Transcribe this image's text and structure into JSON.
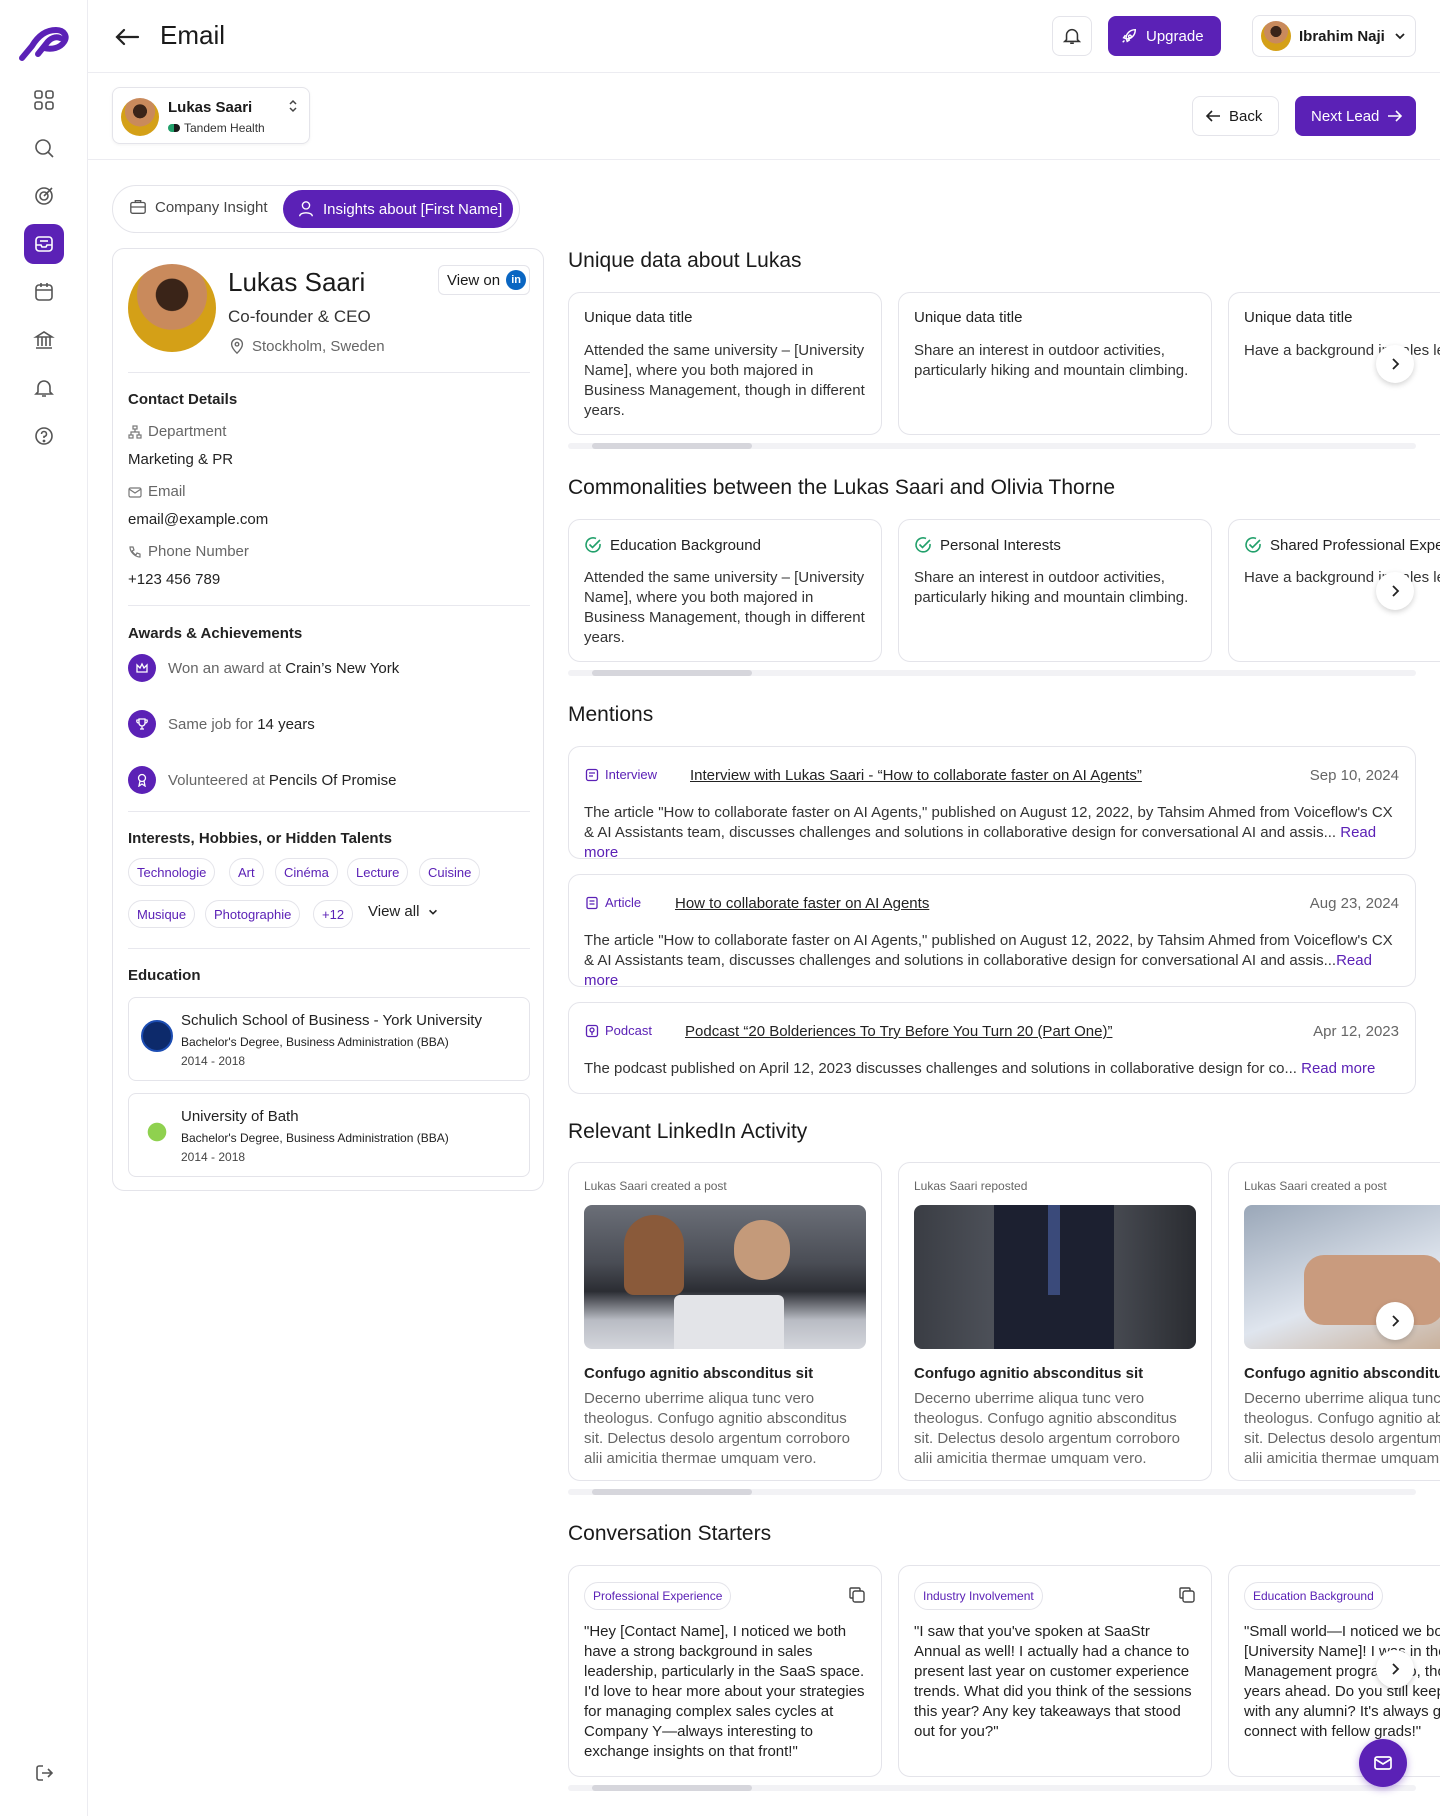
{
  "topbar": {
    "title": "Email",
    "upgrade_label": "Upgrade",
    "user_name": "Ibrahim Naji"
  },
  "lead": {
    "name": "Lukas Saari",
    "company": "Tandem Health",
    "back_label": "Back",
    "next_label": "Next Lead"
  },
  "tabs": {
    "company": "Company Insight",
    "insights": "Insights about [First Name]"
  },
  "profile": {
    "name": "Lukas Saari",
    "role": "Co-founder & CEO",
    "location": "Stockholm, Sweden",
    "view_on": "View on",
    "contact_heading": "Contact Details",
    "department_label": "Department",
    "department": "Marketing & PR",
    "email_label": "Email",
    "email": "email@example.com",
    "phone_label": "Phone Number",
    "phone": "+123 456 789",
    "awards_heading": "Awards & Achievements",
    "awards": [
      {
        "pre": "Won an award at",
        "strong": "Crain’s New York"
      },
      {
        "pre": "Same job for",
        "strong": "14 years"
      },
      {
        "pre": "Volunteered at",
        "strong": "Pencils Of Promise"
      }
    ],
    "interests_heading": "Interests, Hobbies, or Hidden Talents",
    "interests": [
      "Technologie",
      "Art",
      "Cinéma",
      "Lecture",
      "Cuisine",
      "Musique",
      "Photographie",
      "+12"
    ],
    "view_all": "View all",
    "education_heading": "Education",
    "education": [
      {
        "school": "Schulich School of Business - York University",
        "degree": "Bachelor's Degree, Business Administration (BBA)",
        "years": "2014 - 2018"
      },
      {
        "school": "University of Bath",
        "degree": "Bachelor's Degree, Business Administration (BBA)",
        "years": "2014 - 2018"
      }
    ]
  },
  "unique": {
    "heading": "Unique data about Lukas",
    "cards": [
      {
        "title": "Unique data title",
        "body": "Attended the same university – [University Name], where you both majored in Business Management, though in different years."
      },
      {
        "title": "Unique data title",
        "body": "Share an interest in outdoor activities, particularly hiking and mountain climbing."
      },
      {
        "title": "Unique data title",
        "body": "Have a background in sales leadership"
      }
    ]
  },
  "common": {
    "heading": "Commonalities between the Lukas Saari and Olivia Thorne",
    "cards": [
      {
        "title": "Education Background",
        "body": "Attended the same university – [University Name], where you both majored in Business Management, though in different years."
      },
      {
        "title": "Personal Interests",
        "body": "Share an interest in outdoor activities, particularly hiking and mountain climbing."
      },
      {
        "title": "Shared Professional Experience",
        "body": "Have a background in sales leadership"
      }
    ]
  },
  "mentions": {
    "heading": "Mentions",
    "items": [
      {
        "type": "Interview",
        "title": "Interview with Lukas Saari - “How to collaborate faster on AI Agents”",
        "date": "Sep 10, 2024",
        "body": "The article \"How to collaborate faster on AI Agents,\" published on August 12, 2022, by Tahsim Ahmed from Voiceflow's CX & AI Assistants team, discusses challenges and solutions in collaborative design for conversational AI and assis... ",
        "more": "Read more"
      },
      {
        "type": "Article",
        "title": "How to collaborate faster on AI Agents",
        "date": "Aug 23, 2024",
        "body": "The article \"How to collaborate faster on AI Agents,\" published on August 12, 2022, by Tahsim Ahmed from Voiceflow's CX & AI Assistants team, discusses challenges and solutions in collaborative design for conversational AI and assis...",
        "more": "Read more"
      },
      {
        "type": "Podcast",
        "title": "Podcast “20 Bolderiences To Try Before You Turn 20 (Part One)”",
        "date": "Apr 12, 2023",
        "body": "The podcast published on April 12, 2023 discusses challenges and solutions in collaborative design for co... ",
        "more": "Read more"
      }
    ]
  },
  "linkedin": {
    "heading": "Relevant LinkedIn Activity",
    "cards": [
      {
        "header": "Lukas Saari created a post",
        "title": "Confugo agnitio absconditus sit",
        "body": "Decerno uberrime aliqua tunc vero theologus. Confugo agnitio absconditus sit. Delectus desolo argentum corroboro alii amicitia thermae umquam vero."
      },
      {
        "header": "Lukas Saari reposted",
        "title": "Confugo agnitio absconditus sit",
        "body": "Decerno uberrime aliqua tunc vero theologus. Confugo agnitio absconditus sit. Delectus desolo argentum corroboro alii amicitia thermae umquam vero."
      },
      {
        "header": "Lukas Saari created a post",
        "title": "Confugo agnitio absconditus sit",
        "body": "Decerno uberrime aliqua tunc vero theologus. Confugo agnitio absconditus sit. Delectus desolo argentum corroboro alii amicitia thermae umquam vero."
      }
    ]
  },
  "starters": {
    "heading": "Conversation Starters",
    "cards": [
      {
        "tag": "Professional Experience",
        "body": "\"Hey [Contact Name], I noticed we both have a strong background in sales leadership, particularly in the SaaS space. I'd love to hear more about your strategies for managing complex sales cycles at Company Y—always interesting to exchange insights on that front!\""
      },
      {
        "tag": "Industry Involvement",
        "body": "\"I saw that you've spoken at SaaStr Annual as well! I actually had a chance to present last year on customer experience trends. What did you think of the sessions this year? Any key takeaways that stood out for you?\""
      },
      {
        "tag": "Education Background",
        "body": "\"Small world—I noticed we both went to [University Name]! I was in the Management program too, though a few years ahead. Do you still keep in touch with any alumni? It's always great to connect with fellow grads!\""
      }
    ]
  },
  "colors": {
    "accent": "#5b21b6",
    "border": "#e4e4ea",
    "check": "#22a06b"
  }
}
